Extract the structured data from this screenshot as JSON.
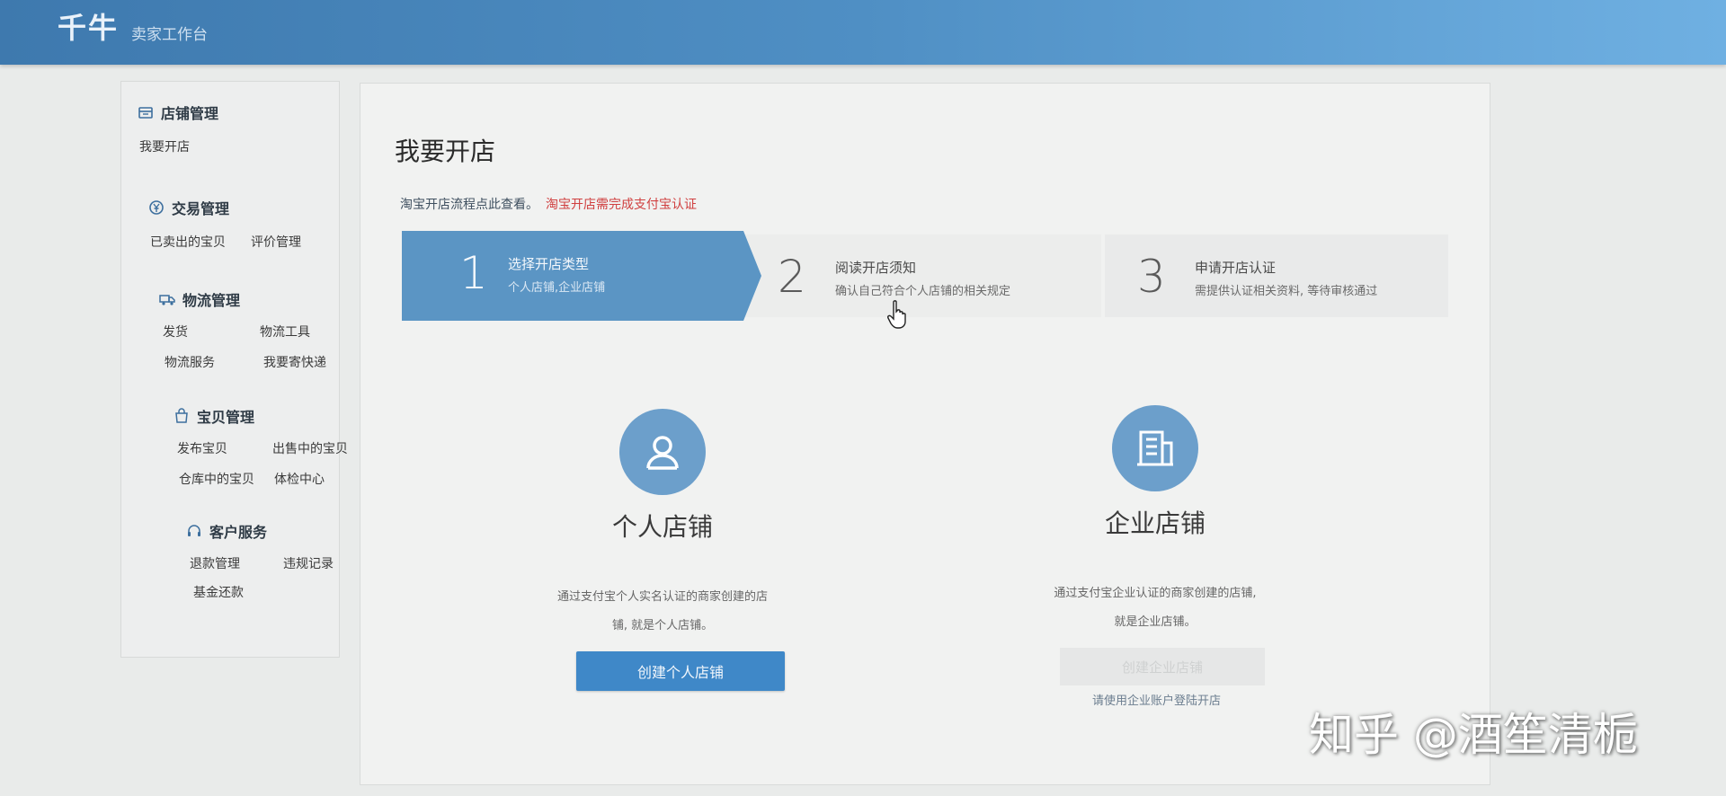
{
  "header": {
    "app_name": "千牛",
    "subtitle": "卖家工作台"
  },
  "sidebar": {
    "sections": [
      {
        "title": "店铺管理",
        "icon": "shop-icon",
        "items": [
          "我要开店"
        ]
      },
      {
        "title": "交易管理",
        "icon": "yen-icon",
        "items": [
          "已卖出的宝贝",
          "评价管理"
        ]
      },
      {
        "title": "物流管理",
        "icon": "truck-icon",
        "items": [
          "发货",
          "物流工具",
          "物流服务",
          "我要寄快递"
        ]
      },
      {
        "title": "宝贝管理",
        "icon": "bag-icon",
        "items": [
          "发布宝贝",
          "出售中的宝贝",
          "仓库中的宝贝",
          "体检中心"
        ]
      },
      {
        "title": "客户服务",
        "icon": "headset-icon",
        "items": [
          "退款管理",
          "违规记录",
          "基金还款"
        ]
      }
    ]
  },
  "main": {
    "title": "我要开店",
    "notice": {
      "link_text": "淘宝开店流程点此查看。",
      "warning": "淘宝开店需完成支付宝认证"
    },
    "steps": [
      {
        "num": "1",
        "title": "选择开店类型",
        "desc": "个人店铺,企业店铺",
        "active": true
      },
      {
        "num": "2",
        "title": "阅读开店须知",
        "desc": "确认自己符合个人店铺的相关规定",
        "active": false
      },
      {
        "num": "3",
        "title": "申请开店认证",
        "desc": "需提供认证相关资料, 等待审核通过",
        "active": false
      }
    ],
    "personal": {
      "title": "个人店铺",
      "desc": "通过支付宝个人实名认证的商家创建的店铺, 就是个人店铺。",
      "button": "创建个人店铺"
    },
    "enterprise": {
      "title": "企业店铺",
      "desc": "通过支付宝企业认证的商家创建的店铺, 就是企业店铺。",
      "button": "创建企业店铺",
      "hint": "请使用企业账户登陆开店"
    }
  },
  "watermark": "知乎 @酒笙清栀",
  "colors": {
    "header": "#4f8fc4",
    "step_active": "#5b95c4",
    "primary_button": "#3f88c8",
    "warning": "#d04040"
  }
}
